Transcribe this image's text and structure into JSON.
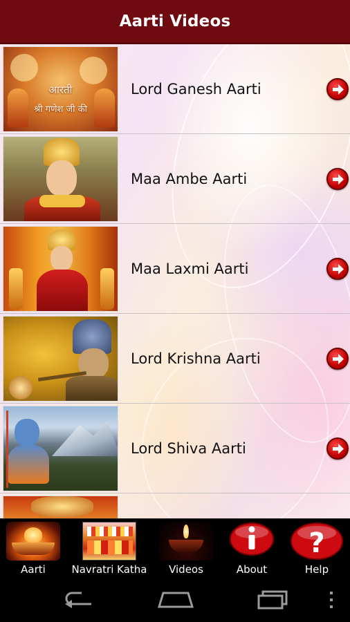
{
  "header": {
    "title": "Aarti Videos"
  },
  "list": {
    "items": [
      {
        "label": "Lord Ganesh Aarti",
        "thumb_icon": "ganesh-thumbnail-icon",
        "thumb_text_line1": "आरती",
        "thumb_text_line2": "श्री गणेश जी की"
      },
      {
        "label": "Maa Ambe Aarti",
        "thumb_icon": "ambe-thumbnail-icon"
      },
      {
        "label": "Maa Laxmi Aarti",
        "thumb_icon": "laxmi-thumbnail-icon"
      },
      {
        "label": "Lord Krishna Aarti",
        "thumb_icon": "krishna-thumbnail-icon"
      },
      {
        "label": "Lord Shiva Aarti",
        "thumb_icon": "shiva-thumbnail-icon"
      }
    ]
  },
  "tabs": [
    {
      "label": "Aarti",
      "icon": "diya-icon"
    },
    {
      "label": "Navratri Katha",
      "icon": "navratri-icon"
    },
    {
      "label": "Videos",
      "icon": "lamp-icon"
    },
    {
      "label": "About",
      "icon": "info-icon"
    },
    {
      "label": "Help",
      "icon": "help-icon"
    }
  ],
  "colors": {
    "header_bg": "#6f0a10",
    "arrow_red": "#d10000",
    "tab_bg": "#000000"
  }
}
